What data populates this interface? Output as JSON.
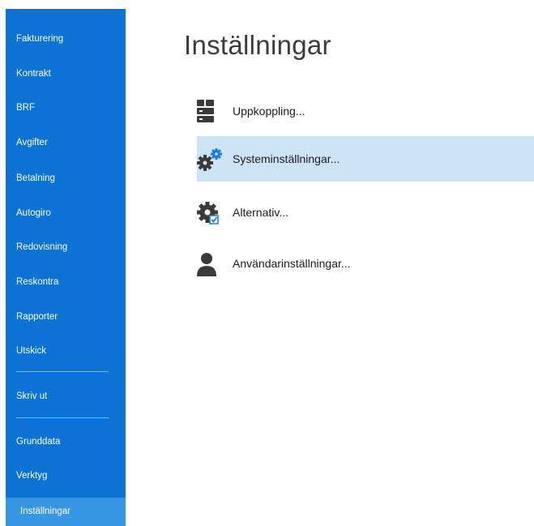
{
  "sidebar": {
    "items": [
      {
        "label": "Fakturering"
      },
      {
        "label": "Kontrakt"
      },
      {
        "label": "BRF"
      },
      {
        "label": "Avgifter"
      },
      {
        "label": "Betalning"
      },
      {
        "label": "Autogiro"
      },
      {
        "label": "Redovisning"
      },
      {
        "label": "Reskontra"
      },
      {
        "label": "Rapporter"
      },
      {
        "label": "Utskick"
      },
      {
        "label": "Skriv ut"
      },
      {
        "label": "Grunddata"
      },
      {
        "label": "Verktyg"
      },
      {
        "label": "Inställningar",
        "selected": true
      }
    ]
  },
  "main": {
    "title": "Inställningar",
    "options": [
      {
        "label": "Uppkoppling...",
        "icon": "server-icon"
      },
      {
        "label": "Systeminställningar...",
        "icon": "gears-icon",
        "highlighted": true
      },
      {
        "label": "Alternativ...",
        "icon": "gear-checkbox-icon"
      },
      {
        "label": "Användarinställningar...",
        "icon": "user-icon"
      }
    ]
  },
  "colors": {
    "sidebar_bg": "#0c73d5",
    "sidebar_selected": "#3796e4",
    "highlight_row": "#cde4f7",
    "icon_dark": "#3a3a3a",
    "icon_accent": "#1a7ad9"
  }
}
